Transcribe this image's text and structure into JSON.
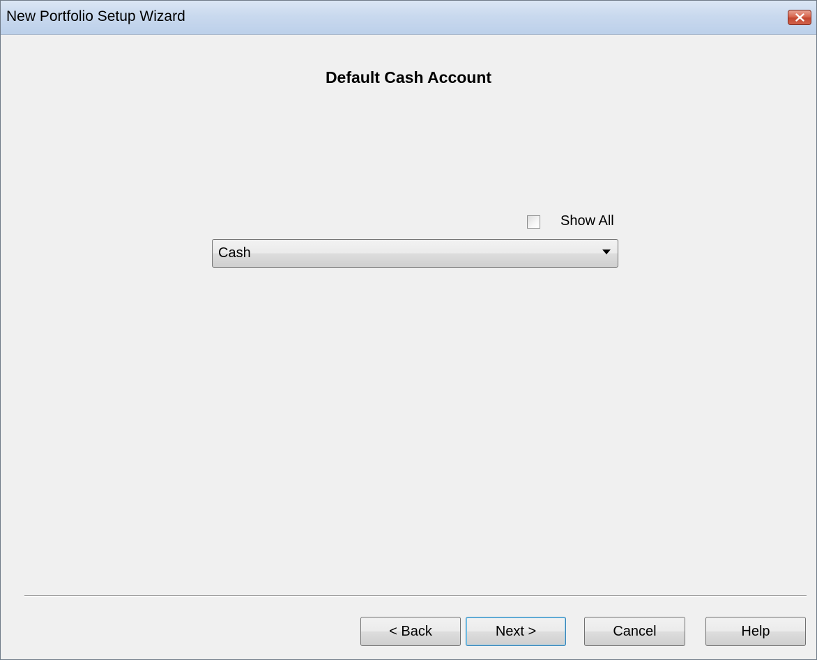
{
  "window": {
    "title": "New Portfolio Setup Wizard"
  },
  "page": {
    "heading": "Default Cash Account"
  },
  "show_all": {
    "label": "Show All",
    "checked": false
  },
  "account_select": {
    "value": "Cash"
  },
  "buttons": {
    "back": "< Back",
    "next": "Next >",
    "cancel": "Cancel",
    "help": "Help"
  },
  "colors": {
    "titlebar": "#c9d9ee",
    "close_button": "#c34832",
    "default_button_border": "#3c7fb1",
    "background": "#f0f0f0"
  },
  "icons": {
    "close": "close-icon",
    "dropdown": "dropdown-arrow-icon"
  }
}
